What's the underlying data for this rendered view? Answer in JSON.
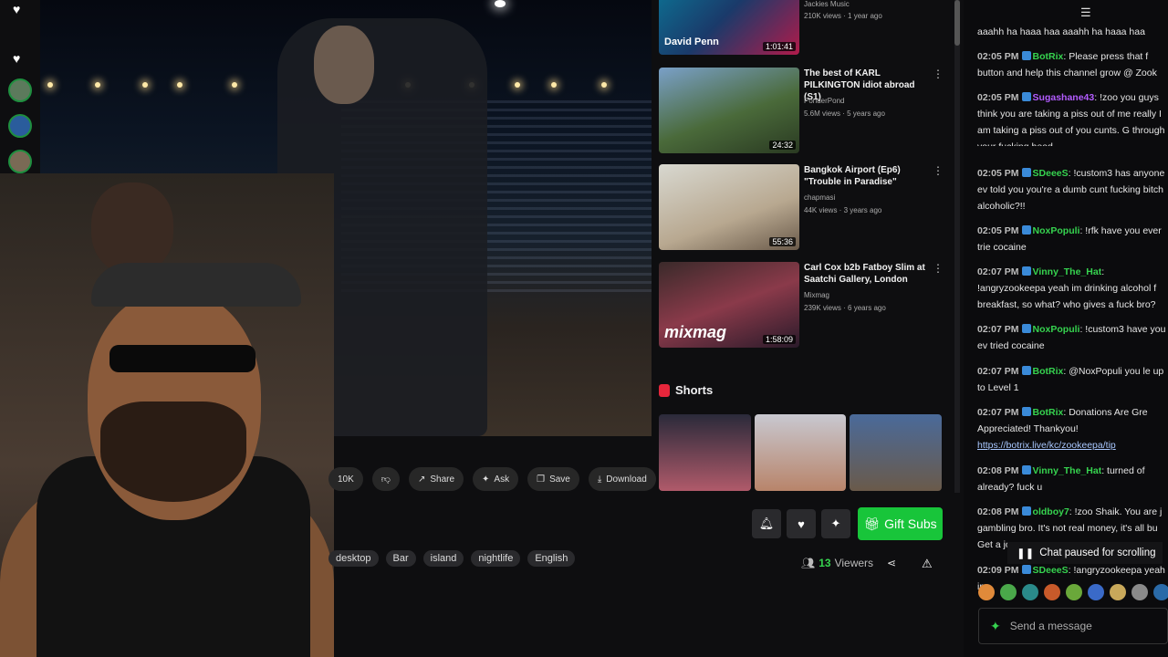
{
  "suggestions": [
    {
      "channel_top": "Jackies Music",
      "meta_top": "210K views · 1 year ago",
      "dur_top": "1:01:41",
      "thumb_name": "David Penn"
    },
    {
      "title": "The best of KARL PILKINGTON idiot abroad (S1)",
      "channel": "PonderPond",
      "meta": "5.6M views · 5 years ago",
      "dur": "24:32"
    },
    {
      "title": "Bangkok Airport (Ep6) \"Trouble in Paradise\"",
      "channel": "chapmasi",
      "meta": "44K views · 3 years ago",
      "dur": "55:36"
    },
    {
      "title": "Carl Cox b2b Fatboy Slim at Saatchi Gallery, London",
      "channel": "Mixmag",
      "meta": "239K views · 6 years ago",
      "dur": "1:58:09",
      "watermark": "mixmag"
    }
  ],
  "shorts_label": "Shorts",
  "actions": {
    "likes": "10K",
    "share": "Share",
    "ask": "Ask",
    "save": "Save",
    "download": "Download"
  },
  "tags": [
    "desktop",
    "Bar",
    "island",
    "nightlife",
    "English"
  ],
  "gift_subs": "Gift Subs",
  "viewers": {
    "count": "13",
    "label": "Viewers"
  },
  "chat": {
    "messages": [
      {
        "time": "",
        "user": "",
        "user_color": "",
        "text": "aaahh ha haaa haa aaahh ha haaa haa"
      },
      {
        "time": "02:05 PM",
        "user": "BotRix",
        "user_color": "#36d34f",
        "text": ": Please press that f button and help this channel grow @ Zook"
      },
      {
        "time": "02:05 PM",
        "user": "Sugashane43",
        "user_color": "#b35cff",
        "text": ": !zoo you guys think you are taking a piss out of me really I am taking a piss out of you cunts. G through your fucking head"
      },
      {
        "time": "02:05 PM",
        "user": "SDeeeS",
        "user_color": "#36d34f",
        "text": ": !custom3 has anyone ev told you you're a dumb cunt fucking bitch alcoholic?!!"
      },
      {
        "time": "02:05 PM",
        "user": "NoxPopuli",
        "user_color": "#36d34f",
        "text": ": !rfk have you ever trie cocaine"
      },
      {
        "time": "02:07 PM",
        "user": "Vinny_The_Hat",
        "user_color": "#36d34f",
        "text": ": !angryzookeepa yeah im drinking alcohol f breakfast, so what? who gives a fuck bro?"
      },
      {
        "time": "02:07 PM",
        "user": "NoxPopuli",
        "user_color": "#36d34f",
        "text": ": !custom3 have you ev tried cocaine"
      },
      {
        "time": "02:07 PM",
        "user": "BotRix",
        "user_color": "#36d34f",
        "text": ": @NoxPopuli you le up to Level 1"
      },
      {
        "time": "02:07 PM",
        "user": "BotRix",
        "user_color": "#36d34f",
        "text": ": Donations Are Gre Appreciated! Thankyou!",
        "link": "https://botrix.live/kc/zookeepa/tip"
      },
      {
        "time": "02:08 PM",
        "user": "Vinny_The_Hat",
        "user_color": "#36d34f",
        "text": ": turned of already? fuck u"
      },
      {
        "time": "02:08 PM",
        "user": "oldboy7",
        "user_color": "#36d34f",
        "text": ": !zoo Shaik. You are j gambling bro. It's not real money, it's all bu Get a jo"
      },
      {
        "time": "02:09 PM",
        "user": "SDeeeS",
        "user_color": "#36d34f",
        "text": ": !angryzookeepa yeah im"
      }
    ],
    "paused_label": "Chat paused for scrolling",
    "input_placeholder": "Send a message"
  }
}
